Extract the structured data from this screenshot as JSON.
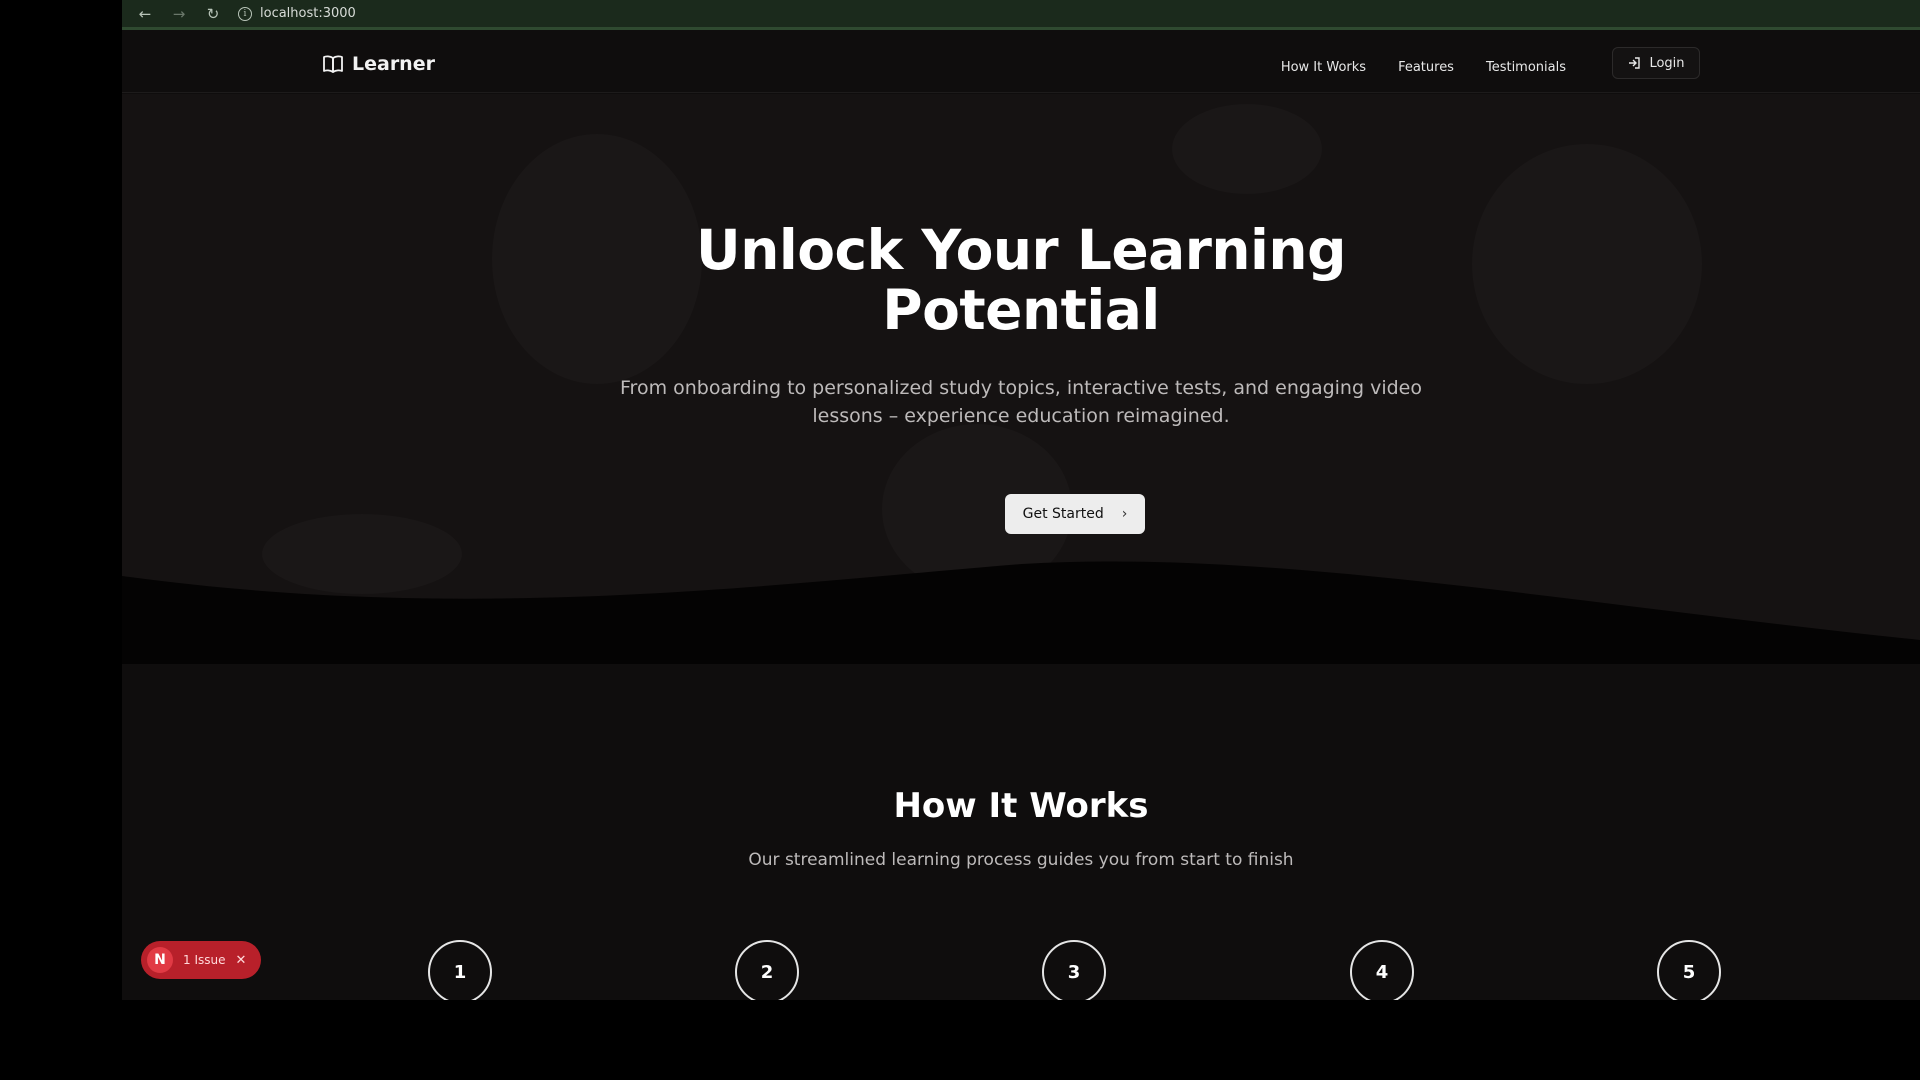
{
  "browser": {
    "url": "localhost:3000",
    "back_icon": "arrow-left-icon",
    "forward_icon": "arrow-right-icon",
    "reload_icon": "reload-icon"
  },
  "header": {
    "logo_text": "Learner",
    "logo_icon": "open-book-icon",
    "nav": [
      "How It Works",
      "Features",
      "Testimonials"
    ],
    "login_label": "Login",
    "login_icon": "login-icon"
  },
  "hero": {
    "title_line1": "Unlock Your Learning",
    "title_line2": "Potential",
    "subtitle_line1": "From onboarding to personalized study topics, interactive tests, and engaging video",
    "subtitle_line2": "lessons – experience education reimagined.",
    "cta_label": "Get Started",
    "cta_icon": "chevron-right-icon"
  },
  "how_it_works": {
    "title": "How It Works",
    "subtitle": "Our streamlined learning process guides you from start to finish",
    "steps": [
      "1",
      "2",
      "3",
      "4",
      "5"
    ]
  },
  "dev_overlay": {
    "logo_letter": "N",
    "issue_label": "1 Issue",
    "close_icon": "close-icon"
  },
  "colors": {
    "page_bg": "#0f0d0d",
    "hero_bg": "#151212",
    "chrome_bg": "#1b2a1c",
    "cta_bg": "#ededed",
    "issue_badge": "#b8202a"
  }
}
